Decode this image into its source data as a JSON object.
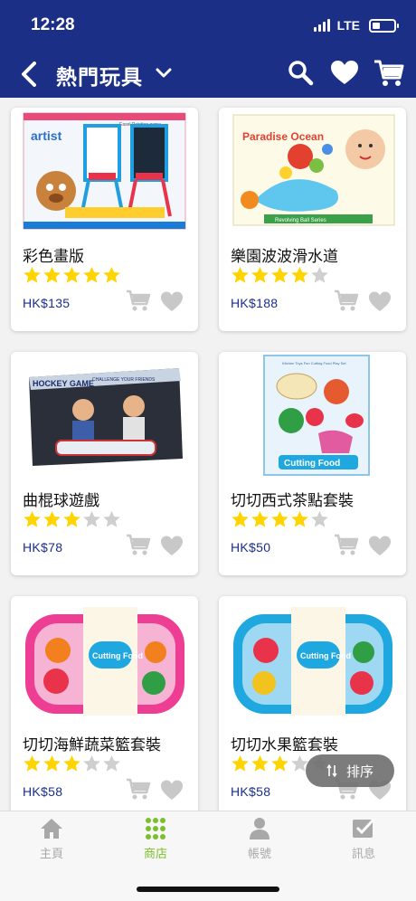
{
  "status": {
    "time": "12:28",
    "network": "LTE"
  },
  "header": {
    "title": "熱門玩具"
  },
  "products": [
    {
      "name": "彩色畫版",
      "rating": 5,
      "price": "HK$135"
    },
    {
      "name": "樂園波波滑水道",
      "rating": 4,
      "price": "HK$188"
    },
    {
      "name": "曲棍球遊戲",
      "rating": 3,
      "price": "HK$78"
    },
    {
      "name": "切切西式茶點套裝",
      "rating": 4,
      "price": "HK$50"
    },
    {
      "name": "切切海鮮蔬菜籃套裝",
      "rating": 3,
      "price": "HK$58"
    },
    {
      "name": "切切水果籃套裝",
      "rating": 3,
      "price": "HK$58"
    }
  ],
  "product_images": [
    {
      "brand": "artist",
      "tagline": "Easel Painting game"
    },
    {
      "brand": "Paradise Ocean",
      "tagline": "Revolving Ball Series"
    },
    {
      "brand": "HOCKEY GAME",
      "tagline": "CHALLENGE YOUR FRIENDS"
    },
    {
      "brand": "Cutting Food",
      "tagline": "Kitchen Toys Fun Cutting Food Play Set"
    },
    {
      "brand": "Cutting Food",
      "tagline": ""
    },
    {
      "brand": "Cutting Food",
      "tagline": ""
    }
  ],
  "sort_button": {
    "label": "排序",
    "icon": "sort-icon"
  },
  "tabs": [
    {
      "label": "主頁",
      "icon": "home-icon",
      "active": false
    },
    {
      "label": "商店",
      "icon": "shop-grid-icon",
      "active": true
    },
    {
      "label": "帳號",
      "icon": "person-icon",
      "active": false
    },
    {
      "label": "訊息",
      "icon": "message-check-icon",
      "active": false
    }
  ],
  "colors": {
    "header": "#1b2f86",
    "star": "#ffd400",
    "star_empty": "#cfcfcf",
    "price": "#1b2f86",
    "tab_active": "#7bbf2a",
    "tab_inactive": "#a8a8a8"
  }
}
